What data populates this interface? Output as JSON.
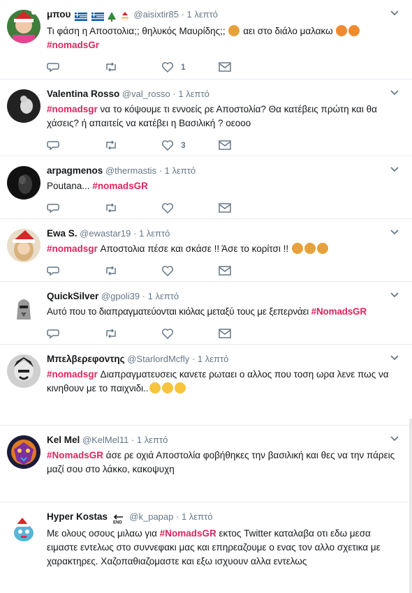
{
  "tweets": [
    {
      "name": "μπου",
      "badges": [
        "greek-flag",
        "greek-flag",
        "christmas-tree",
        "santa"
      ],
      "handle": "@aisixtir85",
      "sep": "·",
      "time": "1 λεπτό",
      "text_before": "Τι φάση η Αποστολια;; θηλυκός Μαυρίδης;;",
      "text_after": "αει στο διάλο μαλακω",
      "hashtag": "#nomadsGr",
      "like_count": "1",
      "avatar_color": "#4a7a3a"
    },
    {
      "name": "Valentina Rosso",
      "handle": "@val_rosso",
      "sep": "·",
      "time": "1 λεπτό",
      "hashtag": "#nomadsgr",
      "text": "να το κόψουμε τι εννοείς ρε Αποστολία? Θα κατέβεις πρώτη και θα χάσεις? ή απαιτείς να κατέβει η Βασιλική ? οεοοο",
      "like_count": "3",
      "avatar_color": "#2b2b2b"
    },
    {
      "name": "arpagmenos",
      "handle": "@thermastis",
      "sep": "·",
      "time": "1 λεπτό",
      "text": "Poutana...",
      "hashtag": "#nomadsGR",
      "avatar_color": "#1e1e1e"
    },
    {
      "name": "Ewa S.",
      "handle": "@ewastar19",
      "sep": "·",
      "time": "1 λεπτό",
      "hashtag": "#nomadsgr",
      "text": "Αποστολια πέσε και σκάσε !! Άσε το κορίτσι !!",
      "avatar_color": "#c8a070"
    },
    {
      "name": "QuickSilver",
      "handle": "@gpoli39",
      "sep": "·",
      "time": "1 λεπτό",
      "text": "Αυτό που το διαπραγματεύονται κιόλας μεταξύ τους με ξεπερνάει",
      "hashtag": "#NomadsGR",
      "avatar_color": "#d9d9d9"
    },
    {
      "name": "Μπελβερεφοντης",
      "handle": "@StarlordMcfly",
      "sep": "·",
      "time": "1 λεπτό",
      "hashtag": "#nomadsgr",
      "text": "Διαπραγματευσεις κανετε ρωταει ο αλλος που τοση ωρα λενε πως να κινηθουν με το παιχνιδι..",
      "avatar_color": "#3a3a3a"
    },
    {
      "name": "Kel Mel",
      "handle": "@KelMel11",
      "sep": "·",
      "time": "1 λεπτό",
      "hashtag": "#NomadsGR",
      "text": "άσε ρε οχιά Αποστολία φοβήθηκες την βασιλική και θες να την πάρεις μαζί σου στο λάκκο, κακοψυχη",
      "avatar_color": "#6a2f8a"
    },
    {
      "name": "Hyper Kostas",
      "handle": "@k_papap",
      "sep": "·",
      "time": "1 λεπτό",
      "text_before": "Με ολους οσους μιλαω για",
      "hashtag": "#NomadsGR",
      "text_after": "εκτος Twitter καταλαβα οτι εδω μεσα ειμαστε εντελως στο συννεφακι μας και επηρεαζουμε ο ενας τον αλλο σχετικα με χαρακτηρες. Χαζοπαθιαζομαστε και εξω ισχυουν αλλα εντελως",
      "avatar_color": "#5ab4d6"
    }
  ],
  "colors": {
    "hashtag": "#e0245e",
    "muted": "#657786",
    "divider": "#e6ecf0"
  }
}
